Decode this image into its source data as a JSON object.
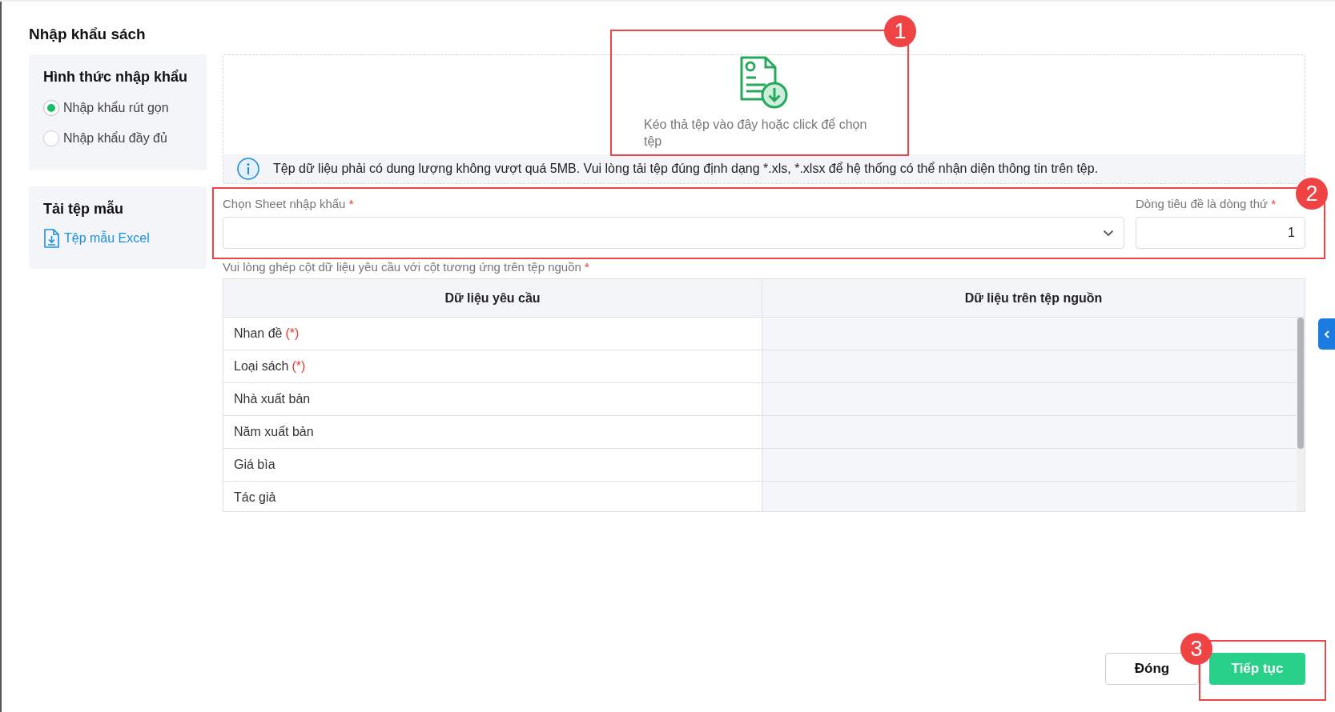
{
  "title": "Nhập khẩu sách",
  "import_mode": {
    "heading": "Hình thức nhập khẩu",
    "options": [
      {
        "label": "Nhập khẩu rút gọn",
        "selected": true
      },
      {
        "label": "Nhập khẩu đầy đủ",
        "selected": false
      }
    ]
  },
  "template": {
    "heading": "Tải tệp mẫu",
    "link": "Tệp mẫu Excel"
  },
  "dropzone": {
    "text": "Kéo thả tệp vào đây hoặc click để chọn tệp",
    "info": "Tệp dữ liệu phải có dung lượng không vượt quá 5MB. Vui lòng tải tệp đúng định dạng *.xls, *.xlsx để hệ thống có thể nhận diện thông tin trên tệp."
  },
  "sheet_field": {
    "label": "Chọn Sheet nhập khẩu",
    "required_mark": "*"
  },
  "header_row_field": {
    "label": "Dòng tiêu đề là dòng thứ",
    "required_mark": "*",
    "value": "1"
  },
  "mapping_note": {
    "text": "Vui lòng ghép cột dữ liệu yêu cầu với cột tương ứng trên tệp nguồn",
    "required_mark": "*"
  },
  "table": {
    "columns": [
      "Dữ liệu yêu cầu",
      "Dữ liệu trên tệp nguồn"
    ],
    "rows": [
      {
        "name": "Nhan đề",
        "required_mark": "(*)"
      },
      {
        "name": "Loại sách",
        "required_mark": "(*)"
      },
      {
        "name": "Nhà xuất bản"
      },
      {
        "name": "Năm xuất bản"
      },
      {
        "name": "Giá bìa"
      },
      {
        "name": "Tác giả"
      }
    ]
  },
  "buttons": [
    {
      "label": "Đóng",
      "kind": "secondary"
    },
    {
      "label": "Tiếp tục",
      "kind": "primary"
    }
  ],
  "annotations": [
    {
      "number": "1"
    },
    {
      "number": "2"
    },
    {
      "number": "3"
    }
  ]
}
